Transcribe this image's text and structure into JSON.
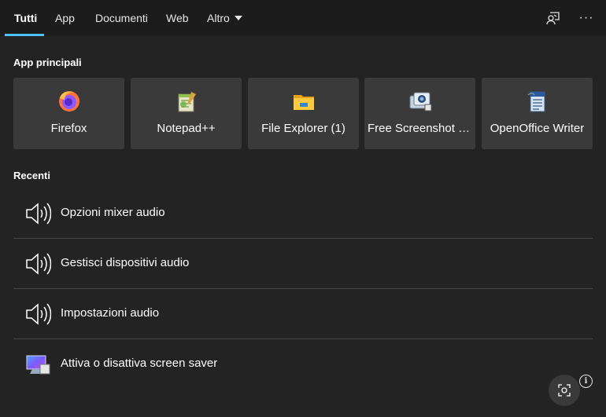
{
  "tabs": [
    {
      "label": "Tutti",
      "active": true
    },
    {
      "label": "App"
    },
    {
      "label": "Documenti"
    },
    {
      "label": "Web"
    },
    {
      "label": "Altro"
    }
  ],
  "header_icons": [
    "feedback-icon",
    "more-options-icon"
  ],
  "header": {
    "more_label": "···"
  },
  "sections": {
    "top_apps": "App principali",
    "recent": "Recenti"
  },
  "top_apps": [
    {
      "label": "Firefox",
      "icon": "firefox-icon"
    },
    {
      "label": "Notepad++",
      "icon": "notepad-plus-plus-icon"
    },
    {
      "label": "File Explorer (1)",
      "icon": "file-explorer-icon"
    },
    {
      "label": "Free Screenshot C...",
      "icon": "free-screenshot-icon"
    },
    {
      "label": "OpenOffice Writer",
      "icon": "openoffice-writer-icon"
    }
  ],
  "recent": [
    {
      "label": "Opzioni mixer audio",
      "icon": "speaker-icon"
    },
    {
      "label": "Gestisci dispositivi audio",
      "icon": "speaker-icon"
    },
    {
      "label": "Impostazioni audio",
      "icon": "speaker-icon"
    },
    {
      "label": "Attiva o disattiva screen saver",
      "icon": "screen-saver-icon"
    }
  ],
  "info_label": "i",
  "colors": {
    "background": "#232323",
    "topbar": "#1c1c1c",
    "tile": "#3a3a3a",
    "accent": "#4cc2ff"
  }
}
